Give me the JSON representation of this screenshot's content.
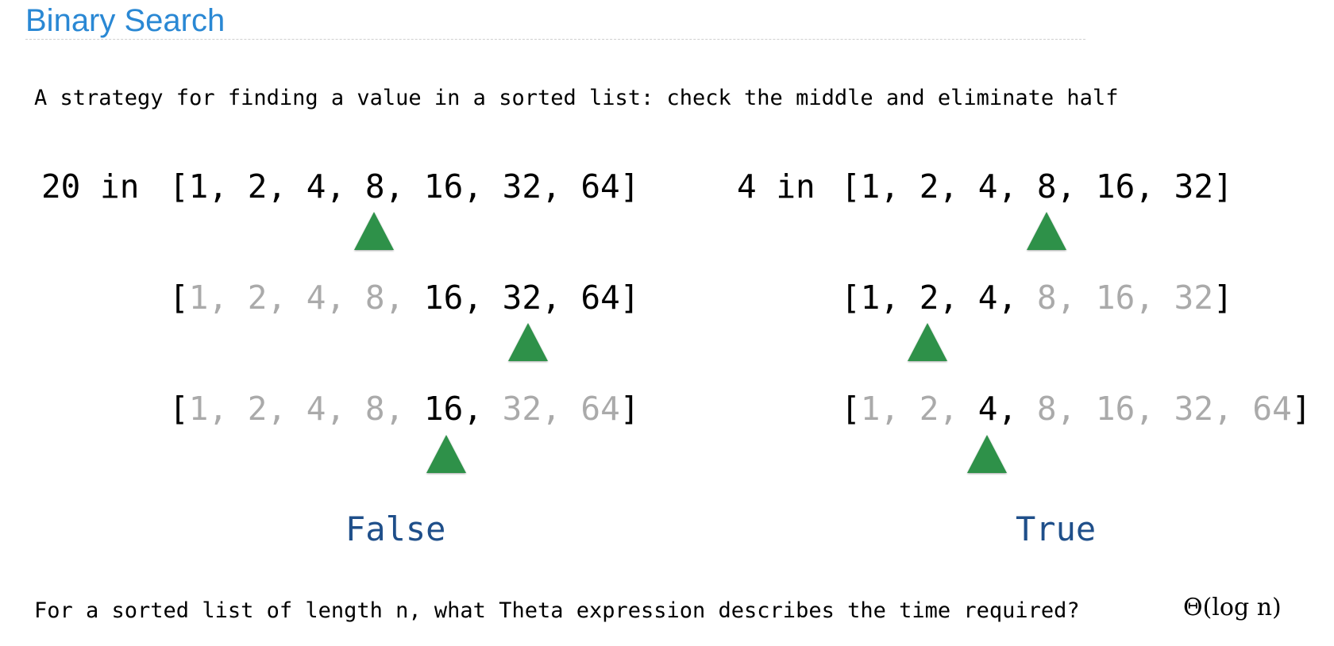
{
  "title": "Binary Search",
  "intro": "A strategy for finding a value in a sorted list: check the middle and eliminate half",
  "left": {
    "query": "20 in ",
    "rows": [
      [
        {
          "t": "[1, 2, 4, 8, 16, 32, 64]",
          "on": true
        }
      ],
      [
        {
          "t": "[",
          "on": true
        },
        {
          "t": "1, 2, 4, 8, ",
          "on": false
        },
        {
          "t": "16, 32, 64]",
          "on": true
        }
      ],
      [
        {
          "t": "[",
          "on": true
        },
        {
          "t": "1, 2, 4, 8, ",
          "on": false
        },
        {
          "t": "16,",
          "on": true
        },
        {
          "t": " 32, 64",
          "on": false
        },
        {
          "t": "]",
          "on": true
        }
      ]
    ],
    "result": "False"
  },
  "right": {
    "query": "4 in ",
    "rows": [
      [
        {
          "t": "[1, 2, 4, 8, 16, 32]",
          "on": true
        }
      ],
      [
        {
          "t": "[1, 2, 4, ",
          "on": true
        },
        {
          "t": "8, 16, 32",
          "on": false
        },
        {
          "t": "]",
          "on": true
        }
      ],
      [
        {
          "t": "[",
          "on": true
        },
        {
          "t": "1, 2, ",
          "on": false
        },
        {
          "t": "4,",
          "on": true
        },
        {
          "t": " 8, 16, 32, 64",
          "on": false
        },
        {
          "t": "]",
          "on": true
        }
      ]
    ],
    "result": "True"
  },
  "question": "For a sorted list of length n, what Theta expression describes the time required?",
  "answer": "Θ(log n)",
  "colors": {
    "title": "#2a88d4",
    "pointer": "#2e9149",
    "result": "#1f4f8a",
    "dim": "#aaaaaa"
  }
}
